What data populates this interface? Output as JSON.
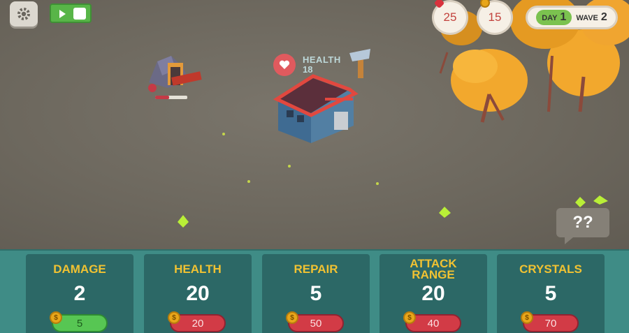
{
  "hud": {
    "gems": "25",
    "coins": "15",
    "day_label": "DAY",
    "day_value": "1",
    "wave_label": "WAVE",
    "wave_value": "2"
  },
  "building": {
    "health_label": "HEALTH",
    "health_value": "18"
  },
  "mystery_bubble": "??",
  "upgrades": [
    {
      "title": "DAMAGE",
      "value": "2",
      "cost": "5",
      "affordable": true
    },
    {
      "title": "HEALTH",
      "value": "20",
      "cost": "20",
      "affordable": false
    },
    {
      "title": "REPAIR",
      "value": "5",
      "cost": "50",
      "affordable": false
    },
    {
      "title": "ATTACK RANGE",
      "value": "20",
      "cost": "40",
      "affordable": false
    },
    {
      "title": "CRYSTALS",
      "value": "5",
      "cost": "70",
      "affordable": false
    }
  ],
  "icons": {
    "settings": "gear-icon",
    "toggle": "play-icon",
    "gem": "gem-icon",
    "coin": "coin-icon",
    "heart": "heart-icon",
    "hammer": "hammer-icon"
  },
  "colors": {
    "panel": "#3f8c86",
    "card": "#2c6866",
    "title": "#f1c232",
    "cost_red": "#d23b46",
    "cost_green": "#57c653"
  }
}
